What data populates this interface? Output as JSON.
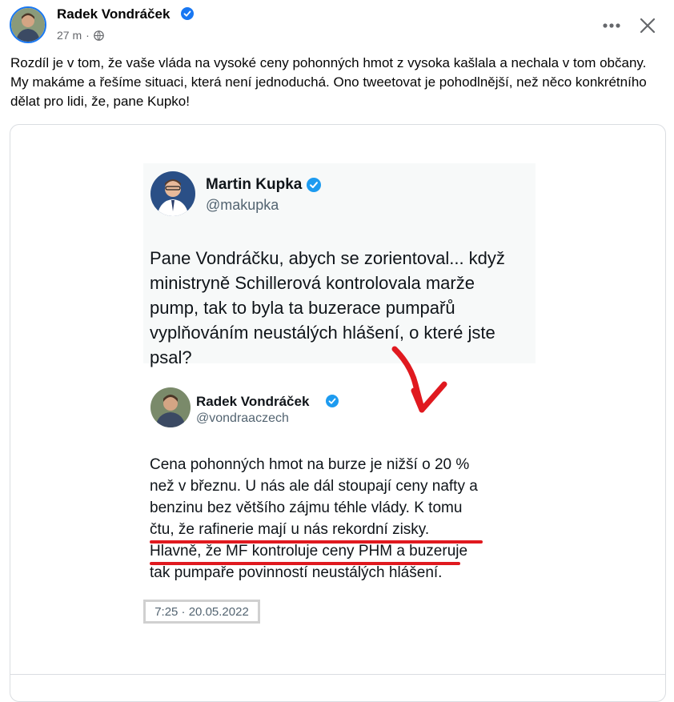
{
  "post": {
    "author": "Radek Vondráček",
    "time": "27 m",
    "separator": "·",
    "text": "Rozdíl je v tom, že vaše vláda na vysoké ceny pohonných hmot z vysoka kašlala a nechala v tom občany. My makáme a řešíme situaci, která není jednoduchá. Ono tweetovat je pohodlnější, než něco konkrétního dělat pro lidi, že, pane Kupko!"
  },
  "icons": {
    "verified": "verified-badge-icon",
    "audience": "globe-icon",
    "more": "more-options-icon",
    "close": "close-icon",
    "arrow": "red-arrow-icon"
  },
  "colors": {
    "brand": "#1877f2",
    "underline": "#e0191f",
    "verified": "#1d9bf0"
  },
  "image": {
    "tweet1": {
      "name": "Martin Kupka",
      "handle": "@makupka",
      "lines": [
        "Pane Vondráčku, abych se zorientoval... když",
        "ministryně Schillerová kontrolovala marže",
        "pump, tak to byla ta buzerace pumpařů",
        "vyplňováním neustálých hlášení, o které jste",
        "psal?"
      ]
    },
    "tweet2": {
      "name": "Radek Vondráček",
      "handle": "@vondraaczech",
      "lines": [
        "Cena pohonných hmot na burze je nižší o 20 %",
        "než v březnu. U nás ale dál stoupají ceny nafty a",
        "benzinu bez většího zájmu téhle vlády. K tomu",
        "čtu, že rafinerie mají u nás rekordní zisky.",
        "Hlavně, že MF kontroluje ceny PHM a buzeruje",
        "tak pumpaře povinností neustálých hlášení."
      ],
      "timestamp": "7:25 · 20.05.2022"
    }
  }
}
